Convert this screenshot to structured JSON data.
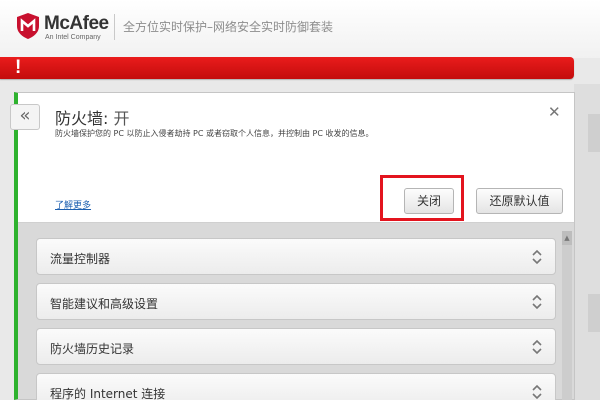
{
  "brand": {
    "name": "McAfee",
    "sub": "An Intel Company",
    "shield_color": "#c8102e"
  },
  "header": {
    "product": "全方位实时保护–网络安全实时防御套装"
  },
  "alert": {
    "mark": "!",
    "color": "#d81515"
  },
  "firewall": {
    "title": "防火墙",
    "separator": ": ",
    "state": "开",
    "description": "防火墙保护您的 PC 以防止入侵者劫持 PC 或者窃取个人信息，并控制由 PC 收发的信息。",
    "learn_more": "了解更多",
    "off_button": "关闭",
    "reset_button": "还原默认值",
    "status_color": "#2eb22e"
  },
  "sections": [
    {
      "label": "流量控制器"
    },
    {
      "label": "智能建议和高级设置"
    },
    {
      "label": "防火墙历史记录"
    },
    {
      "label": "程序的 Internet 连接"
    }
  ],
  "icons": {
    "collapse": "double-chevron-left-icon",
    "close": "close-icon",
    "expand": "chevron-up-down-icon"
  }
}
